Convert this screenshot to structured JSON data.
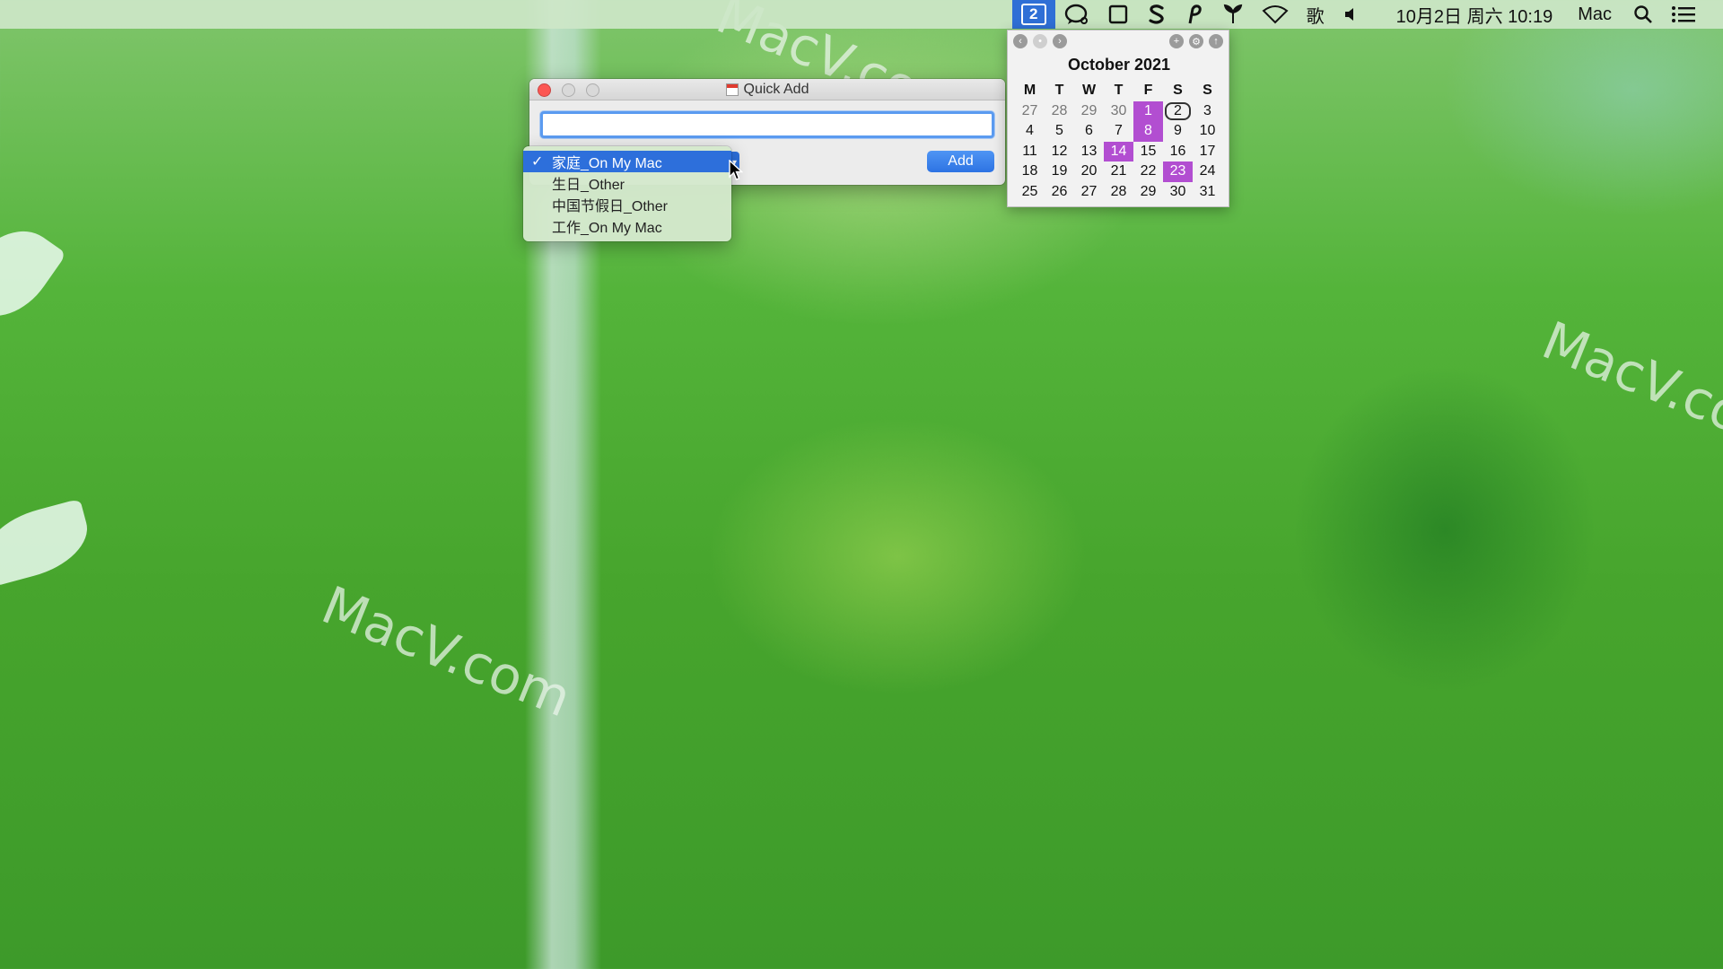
{
  "menubar": {
    "status_badge": "2",
    "date_time": "10月2日 周六 10:19",
    "user": "Mac",
    "input_method": "歌"
  },
  "watermarks": [
    "MacV.com",
    "MacV.com",
    "MacV.co"
  ],
  "quick_add": {
    "title": "Quick Add",
    "input_value": "",
    "add_label": "Add",
    "colors": {
      "accent": "#2d6fdb",
      "close": "#fc5753"
    }
  },
  "calendar_menu": {
    "options": [
      "家庭_On My Mac",
      "生日_Other",
      "中国节假日_Other",
      "工作_On My Mac"
    ],
    "selected": "家庭_On My Mac",
    "check": "✓"
  },
  "mini_calendar": {
    "month_title": "October 2021",
    "weekdays": [
      "M",
      "T",
      "W",
      "T",
      "F",
      "S",
      "S"
    ],
    "days": [
      {
        "d": "27",
        "muted": true
      },
      {
        "d": "28",
        "muted": true
      },
      {
        "d": "29",
        "muted": true
      },
      {
        "d": "30",
        "muted": true
      },
      {
        "d": "1",
        "event": true
      },
      {
        "d": "2",
        "today": true
      },
      {
        "d": "3"
      },
      {
        "d": "4"
      },
      {
        "d": "5"
      },
      {
        "d": "6"
      },
      {
        "d": "7"
      },
      {
        "d": "8",
        "event": true
      },
      {
        "d": "9"
      },
      {
        "d": "10"
      },
      {
        "d": "11"
      },
      {
        "d": "12"
      },
      {
        "d": "13"
      },
      {
        "d": "14",
        "event": true
      },
      {
        "d": "15"
      },
      {
        "d": "16"
      },
      {
        "d": "17"
      },
      {
        "d": "18"
      },
      {
        "d": "19"
      },
      {
        "d": "20"
      },
      {
        "d": "21"
      },
      {
        "d": "22"
      },
      {
        "d": "23",
        "event": true
      },
      {
        "d": "24"
      },
      {
        "d": "25"
      },
      {
        "d": "26"
      },
      {
        "d": "27"
      },
      {
        "d": "28"
      },
      {
        "d": "29"
      },
      {
        "d": "30"
      },
      {
        "d": "31"
      }
    ],
    "event_color": "#b24ed1"
  }
}
